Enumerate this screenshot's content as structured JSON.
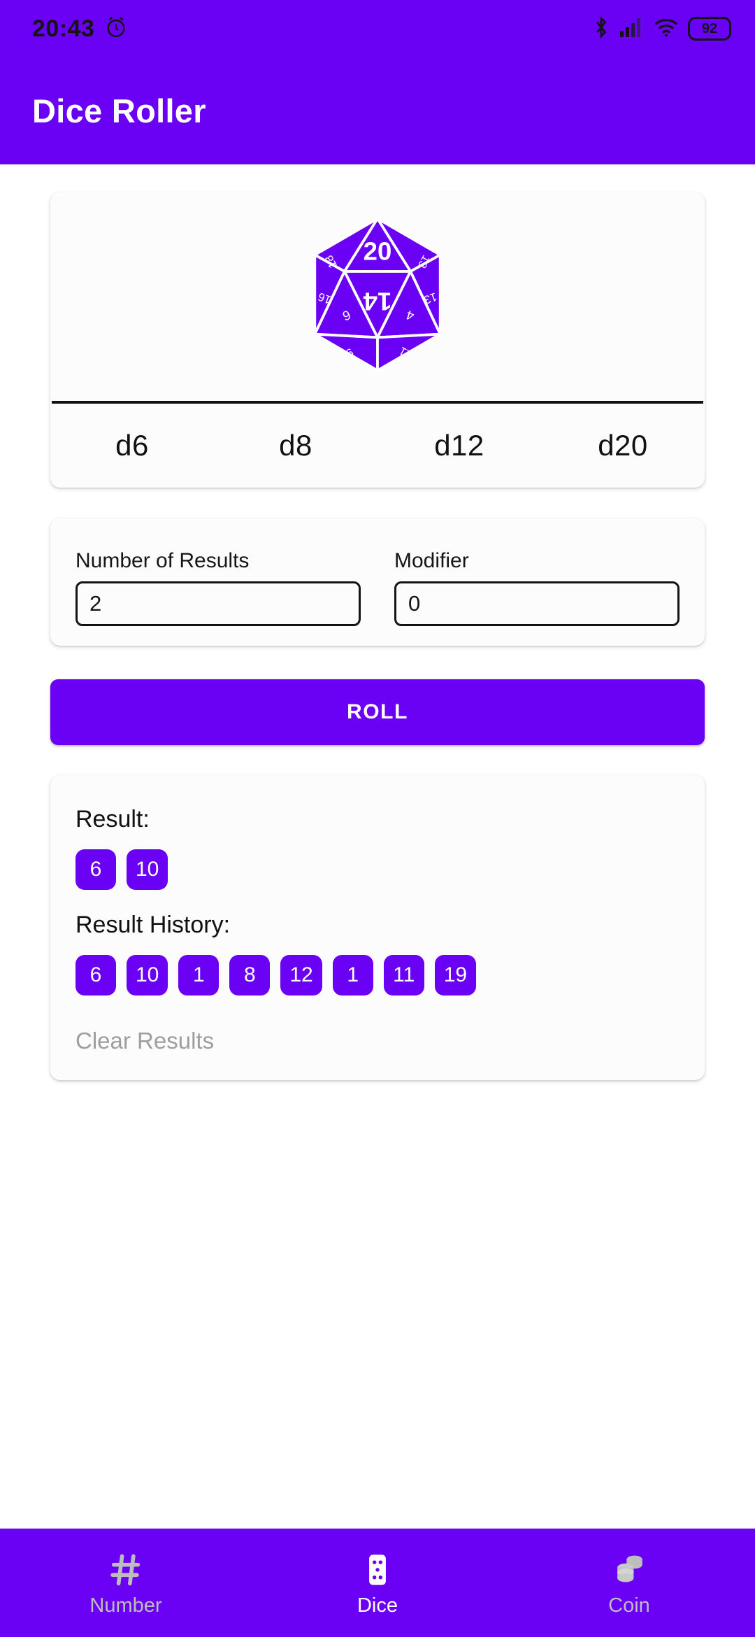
{
  "status_bar": {
    "time": "20:43",
    "alarm_icon": "alarm-icon",
    "bluetooth_icon": "bluetooth-icon",
    "signal_icon": "cellular-signal-icon",
    "wifi_icon": "wifi-icon",
    "battery_level": "92"
  },
  "app_bar": {
    "title": "Dice Roller"
  },
  "dice_card": {
    "preview_icon": "d20-dice-icon",
    "preview_face_top": "20",
    "preview_face_center": "14",
    "preview_faces": [
      "18",
      "13",
      "16",
      "12",
      "6",
      "4",
      "9",
      "11"
    ],
    "types": [
      {
        "label": "d6"
      },
      {
        "label": "d8"
      },
      {
        "label": "d12"
      },
      {
        "label": "d20"
      }
    ],
    "selected_type": "d20"
  },
  "inputs": {
    "number_of_results": {
      "label": "Number of Results",
      "value": "2",
      "placeholder": "2"
    },
    "modifier": {
      "label": "Modifier",
      "value": "0",
      "placeholder": "0"
    }
  },
  "roll_button": {
    "label": "ROLL"
  },
  "results": {
    "result_label": "Result:",
    "result_values": [
      "6",
      "10"
    ],
    "history_label": "Result History:",
    "history_values": [
      "6",
      "10",
      "1",
      "8",
      "12",
      "1",
      "11",
      "19"
    ],
    "clear_label": "Clear Results"
  },
  "bottom_nav": {
    "items": [
      {
        "label": "Number",
        "icon": "hash-icon",
        "active": false
      },
      {
        "label": "Dice",
        "icon": "dice-icon",
        "active": true
      },
      {
        "label": "Coin",
        "icon": "coin-stack-icon",
        "active": false
      }
    ]
  },
  "colors": {
    "primary": "#6A00F4",
    "on_primary": "#FFFFFF",
    "chip": "#6A00F4",
    "inactive_nav": "#BDBDBD",
    "muted_text": "#9E9E9E"
  }
}
